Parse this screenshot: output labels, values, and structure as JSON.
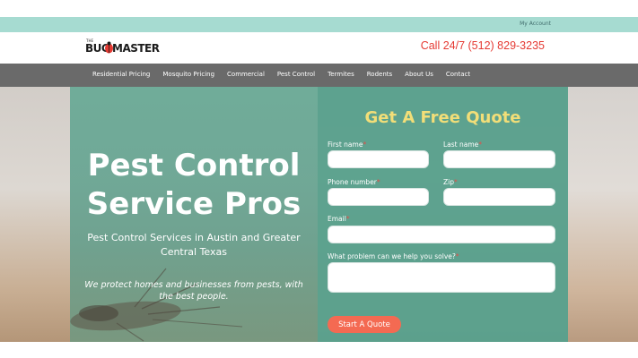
{
  "topbar": {
    "account_link": "My Account"
  },
  "header": {
    "logo": {
      "the": "THE",
      "bug": "BUG",
      "master": "MASTER"
    },
    "phone": "Call 24/7 (512) 829-3235"
  },
  "nav": {
    "items": [
      {
        "label": "Residential Pricing"
      },
      {
        "label": "Mosquito Pricing"
      },
      {
        "label": "Commercial"
      },
      {
        "label": "Pest Control"
      },
      {
        "label": "Termites"
      },
      {
        "label": "Rodents"
      },
      {
        "label": "About Us"
      },
      {
        "label": "Contact"
      }
    ]
  },
  "hero": {
    "title_line1": "Pest Control",
    "title_line2": "Service Pros",
    "subtitle": "Pest Control Services in Austin and Greater Central Texas",
    "tagline": "We protect homes and businesses from pests, with the best people."
  },
  "form": {
    "title": "Get A Free Quote",
    "first_name_label": "First name",
    "last_name_label": "Last name",
    "phone_label": "Phone number",
    "zip_label": "Zip",
    "email_label": "Email",
    "problem_label": "What problem can we help you solve?",
    "required_mark": "*",
    "first_name_value": "",
    "last_name_value": "",
    "phone_value": "",
    "zip_value": "",
    "email_value": "",
    "problem_value": "",
    "submit_label": "Start A Quote"
  },
  "colors": {
    "topbar": "#a6dbd1",
    "nav": "#6a6a6a",
    "phone": "#e53a33",
    "form_panel": "#58a08c",
    "form_title": "#f2de78",
    "button": "#f46a52",
    "required": "#e2504a"
  },
  "icons": {
    "logo_bug": "bug-icon"
  }
}
